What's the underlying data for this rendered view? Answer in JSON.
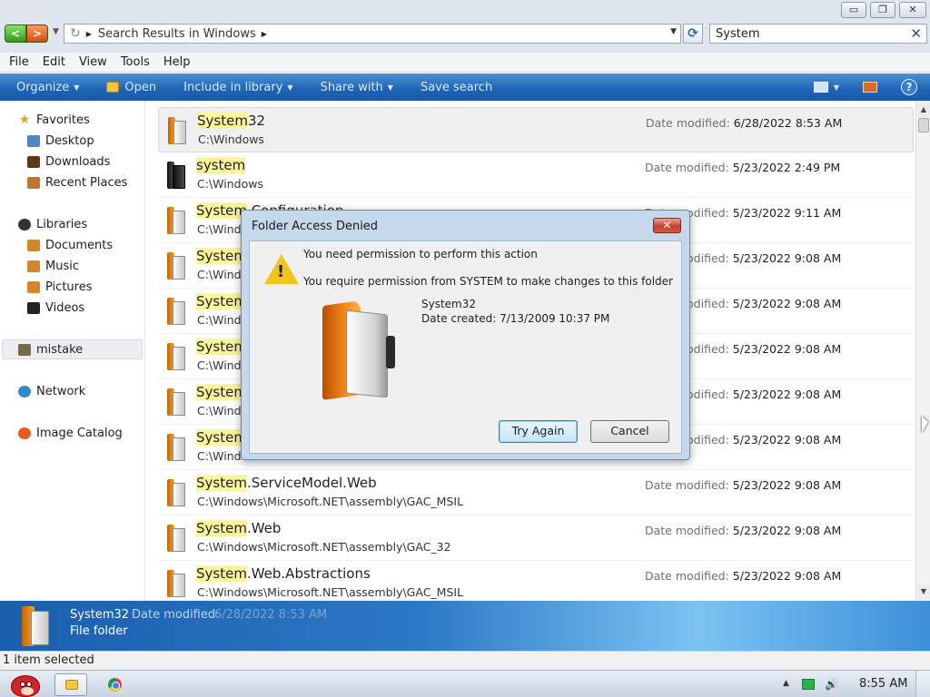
{
  "window": {
    "minimize": "▭",
    "maximize": "❐",
    "close": "✕"
  },
  "address": {
    "crumb": "Search Results in Windows"
  },
  "search": {
    "value": "System"
  },
  "menu": [
    "File",
    "Edit",
    "View",
    "Tools",
    "Help"
  ],
  "commands": {
    "organize": "Organize",
    "open": "Open",
    "include_in_library": "Include in library",
    "share_with": "Share with",
    "save_search": "Save search"
  },
  "navpane": {
    "favorites": "Favorites",
    "desktop": "Desktop",
    "downloads": "Downloads",
    "recent_places": "Recent Places",
    "libraries": "Libraries",
    "documents": "Documents",
    "music": "Music",
    "pictures": "Pictures",
    "videos": "Videos",
    "mistake": "mistake",
    "network": "Network",
    "image_catalog": "Image Catalog"
  },
  "files": {
    "date_label": "Date modified:",
    "rows": [
      {
        "hl": "System",
        "rest": "32",
        "path": "C:\\Windows",
        "date": "6/28/2022 8:53 AM"
      },
      {
        "hl": "system",
        "rest": "",
        "path": "C:\\Windows",
        "date": "5/23/2022 2:49 PM"
      },
      {
        "hl": "System",
        "rest": ".Configuration",
        "path": "C:\\Windows",
        "date": "5/23/2022 9:11 AM"
      },
      {
        "hl": "System",
        "rest": "",
        "path": "C:\\Windows",
        "date": "5/23/2022 9:08 AM"
      },
      {
        "hl": "System",
        "rest": "",
        "path": "C:\\Windows",
        "date": "5/23/2022 9:08 AM"
      },
      {
        "hl": "System",
        "rest": "",
        "path": "C:\\Windows",
        "date": "5/23/2022 9:08 AM"
      },
      {
        "hl": "System",
        "rest": "",
        "path": "C:\\Windows",
        "date": "5/23/2022 9:08 AM"
      },
      {
        "hl": "System",
        "rest": "",
        "path": "C:\\Windows",
        "date": "5/23/2022 9:08 AM"
      },
      {
        "hl": "System",
        "rest": ".ServiceModel.Web",
        "path": "C:\\Windows\\Microsoft.NET\\assembly\\GAC_MSIL",
        "date": "5/23/2022 9:08 AM"
      },
      {
        "hl": "System",
        "rest": ".Web",
        "path": "C:\\Windows\\Microsoft.NET\\assembly\\GAC_32",
        "date": "5/23/2022 9:08 AM"
      },
      {
        "hl": "System",
        "rest": ".Web.Abstractions",
        "path": "C:\\Windows\\Microsoft.NET\\assembly\\GAC_MSIL",
        "date": "5/23/2022 9:08 AM"
      }
    ]
  },
  "details": {
    "name": "System32",
    "date_label": "Date modified:",
    "date_value": "6/28/2022 8:53 AM",
    "type": "File folder"
  },
  "status": {
    "text": "1 item selected"
  },
  "taskbar": {
    "time": "8:55 AM"
  },
  "dialog": {
    "title": "Folder Access Denied",
    "message1": "You need permission to perform this action",
    "message2": "You require permission from SYSTEM to make changes to this folder",
    "folder_name": "System32",
    "date_created": "Date created: 7/13/2009 10:37 PM",
    "try_again": "Try Again",
    "cancel": "Cancel"
  }
}
